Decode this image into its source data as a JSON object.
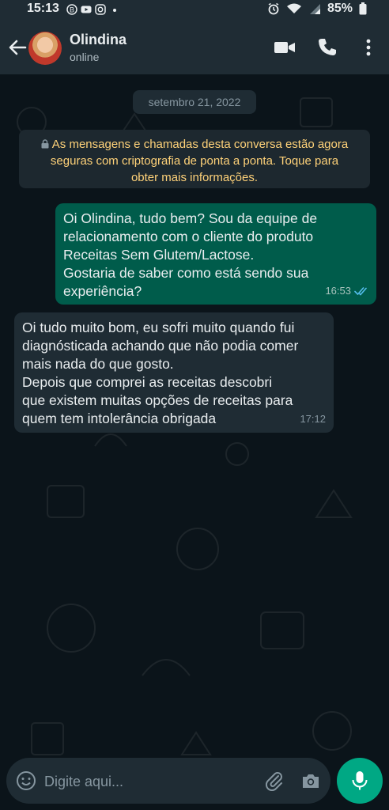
{
  "status_bar": {
    "time": "15:13",
    "left_icons": [
      "b-icon",
      "youtube-icon",
      "instagram-icon",
      "dot-icon"
    ],
    "right_icons": [
      "alarm-icon",
      "wifi-icon",
      "signal-icon"
    ],
    "battery": "85%"
  },
  "header": {
    "contact_name": "Olindina",
    "contact_status": "online",
    "icons": [
      "back-arrow-icon",
      "video-call-icon",
      "voice-call-icon",
      "more-options-icon"
    ]
  },
  "chat": {
    "date_chip": "setembro 21, 2022",
    "encryption_notice": {
      "lines": [
        "As mensagens e chamadas desta conversa estão agora",
        "seguras com criptografia de ponta a ponta. Toque para",
        "obter mais informações."
      ]
    },
    "messages": [
      {
        "direction": "outgoing",
        "lines": [
          "Oi Olindina, tudo bem? Sou da equipe de",
          "relacionamento com o cliente do produto",
          "Receitas Sem Glutem/Lactose.",
          "Gostaria de saber como está sendo sua",
          "experiência?"
        ],
        "time": "16:53",
        "status": "read"
      },
      {
        "direction": "incoming",
        "lines": [
          "Oi tudo muito bom, eu sofri muito quando fui",
          "diagnósticada achando que não podia comer",
          "mais nada do que gosto.",
          "Depois que comprei as receitas descobri",
          "que existem muitas opções de receitas para",
          "quem tem intolerância obrigada"
        ],
        "time": "17:12"
      }
    ]
  },
  "composer": {
    "placeholder": "Digite aqui...",
    "value": "",
    "icons": [
      "emoji-icon",
      "attach-icon",
      "camera-icon",
      "mic-icon"
    ]
  },
  "colors": {
    "background": "#0b141a",
    "bar": "#1f2c34",
    "outgoing_bubble": "#005c4b",
    "incoming_bubble": "#1f2c34",
    "accent": "#00a884",
    "notice_text": "#ffd279",
    "read_ticks": "#53bdeb"
  }
}
